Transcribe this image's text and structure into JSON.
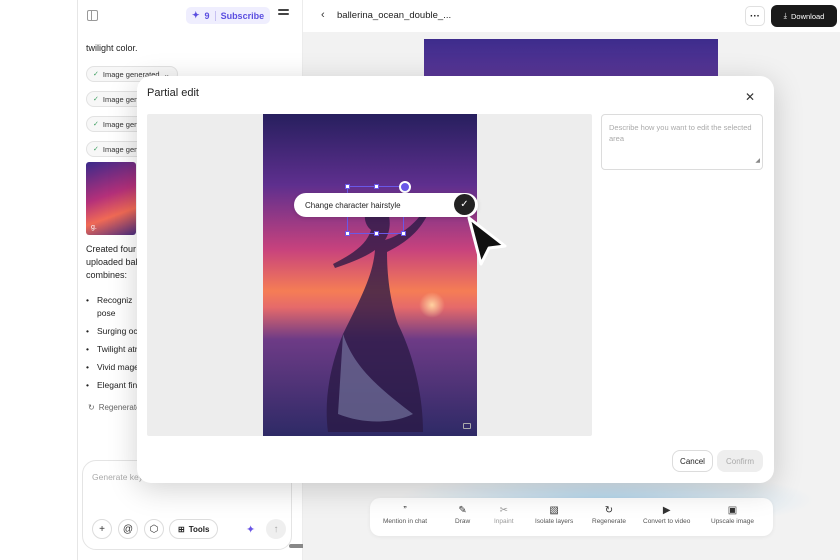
{
  "left_panel": {
    "credits": {
      "count": "9",
      "subscribe": "Subscribe"
    },
    "intro_text": "twilight color.",
    "chips": [
      "Image generated",
      "Image gene",
      "Image gene",
      "Image gene"
    ],
    "thumb_label": "g.",
    "body_lines": [
      "Created four",
      "uploaded ball",
      "combines:"
    ],
    "bullets": [
      {
        "l1": "Recogniz",
        "l2": "pose"
      },
      {
        "l1": "Surging oc"
      },
      {
        "l1": "Twilight atr"
      },
      {
        "l1": "Vivid mage"
      },
      {
        "l1": "Elegant fin"
      }
    ],
    "regenerate": "Regenerate",
    "composer": {
      "placeholder": "Generate key",
      "tools": "Tools"
    }
  },
  "header": {
    "filename": "ballerina_ocean_double_...",
    "download": "Download"
  },
  "modal": {
    "title": "Partial edit",
    "prompt_text": "Change character hairstyle",
    "description_placeholder": "Describe how you want to edit the selected area",
    "cancel": "Cancel",
    "confirm": "Confirm"
  },
  "toolbar": {
    "items": [
      {
        "label": "Mention in chat",
        "icon": "quote-icon",
        "glyph": "”"
      },
      {
        "label": "Draw",
        "icon": "pen-icon",
        "glyph": "✎"
      },
      {
        "label": "Inpaint",
        "icon": "scissors-icon",
        "glyph": "✂"
      },
      {
        "label": "Isolate layers",
        "icon": "layers-icon",
        "glyph": "▧"
      },
      {
        "label": "Regenerate",
        "icon": "refresh-icon",
        "glyph": "↻"
      },
      {
        "label": "Convert to video",
        "icon": "play-icon",
        "glyph": "▶"
      },
      {
        "label": "Upscale image",
        "icon": "upscale-icon",
        "glyph": "▣"
      }
    ]
  },
  "colors": {
    "accent": "#6a58e8",
    "dark_button": "#1a1a1a"
  }
}
